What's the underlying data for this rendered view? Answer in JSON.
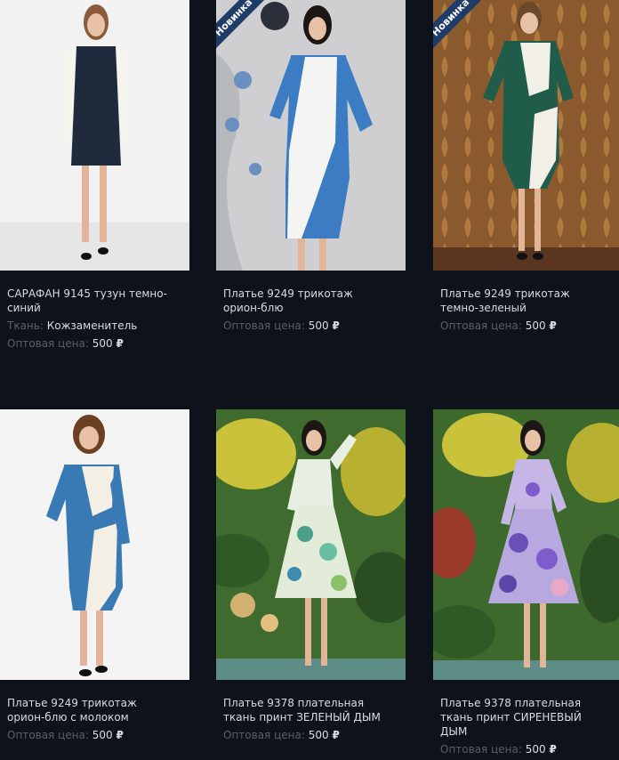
{
  "products": [
    {
      "title": "САРАФАН 9145 тузун темно-синий",
      "badge": "",
      "fabric_label": "Ткань:",
      "fabric_value": "Кожзаменитель",
      "price_label": "Оптовая цена:",
      "price_value": "500",
      "currency": "₽",
      "image_subject": "woman in navy pinafore dress over white blouse"
    },
    {
      "title": "Платье 9249 трикотаж орион-блю",
      "badge": "Новинка",
      "price_label": "Оптовая цена:",
      "price_value": "500",
      "currency": "₽",
      "image_subject": "woman in blue and white color-block dress"
    },
    {
      "title": "Платье 9249 трикотаж темно-зеленый",
      "badge": "Новинка",
      "price_label": "Оптовая цена:",
      "price_value": "500",
      "currency": "₽",
      "image_subject": "woman in green and white color-block dress"
    },
    {
      "title": "Платье 9249 трикотаж орион-блю с молоком",
      "badge": "",
      "price_label": "Оптовая цена:",
      "price_value": "500",
      "currency": "₽",
      "image_subject": "woman in blue and cream color-block dress"
    },
    {
      "title": "Платье 9378 плательная ткань принт ЗЕЛЕНЫЙ ДЫМ",
      "badge": "",
      "price_label": "Оптовая цена:",
      "price_value": "500",
      "currency": "₽",
      "image_subject": "woman in green floral print dress"
    },
    {
      "title": "Платье 9378 плательная ткань принт СИРЕНЕВЫЙ ДЫМ",
      "badge": "",
      "price_label": "Оптовая цена:",
      "price_value": "500",
      "currency": "₽",
      "image_subject": "woman in lilac floral print dress"
    }
  ],
  "colors": {
    "page_background": "#0e121b",
    "badge_background": "#1f3c68",
    "title_text": "#d9dce2",
    "muted_text": "#5a5f69"
  }
}
